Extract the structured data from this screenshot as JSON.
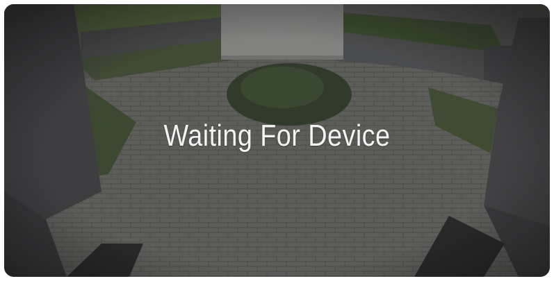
{
  "feed": {
    "status_text": "Waiting For Device"
  }
}
